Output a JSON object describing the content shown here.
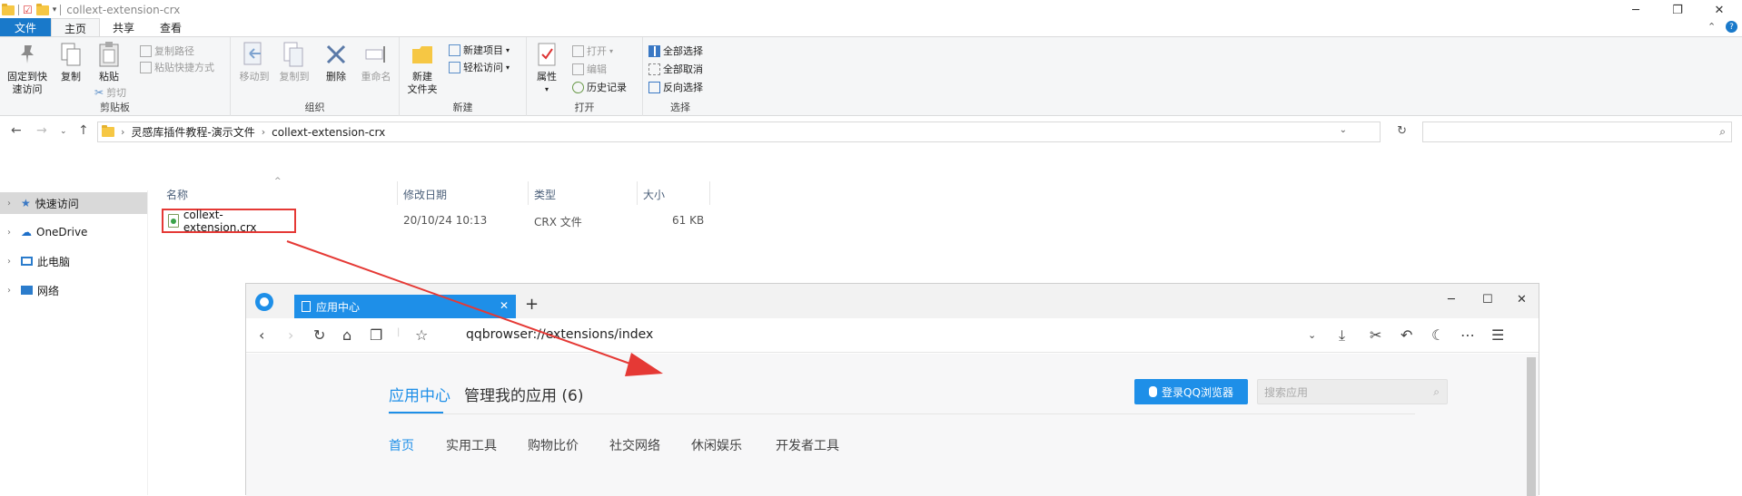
{
  "window": {
    "title": "collext-extension-crx"
  },
  "ribbon_tabs": [
    "文件",
    "主页",
    "共享",
    "查看"
  ],
  "ribbon": {
    "clipboard": {
      "label": "剪贴板",
      "pin": "固定到快\n速访问",
      "copy": "复制",
      "paste": "粘贴",
      "copy_path": "复制路径",
      "paste_shortcut": "粘贴快捷方式",
      "cut": "剪切"
    },
    "organize": {
      "label": "组织",
      "move_to": "移动到",
      "copy_to": "复制到",
      "delete": "删除",
      "rename": "重命名"
    },
    "new": {
      "label": "新建",
      "new_folder": "新建\n文件夹",
      "new_item": "新建项目",
      "easy_access": "轻松访问"
    },
    "open": {
      "label": "打开",
      "properties": "属性",
      "open": "打开",
      "edit": "编辑",
      "history": "历史记录"
    },
    "select": {
      "label": "选择",
      "select_all": "全部选择",
      "select_none": "全部取消",
      "invert": "反向选择"
    }
  },
  "address": {
    "crumbs": [
      "灵感库插件教程-演示文件",
      "collext-extension-crx"
    ]
  },
  "navpane": [
    "快速访问",
    "OneDrive",
    "此电脑",
    "网络"
  ],
  "columns": [
    "名称",
    "修改日期",
    "类型",
    "大小"
  ],
  "file": {
    "name": "collext-extension.crx",
    "date": "20/10/24 10:13",
    "type": "CRX 文件",
    "size": "61 KB"
  },
  "browser": {
    "tab_title": "应用中心",
    "url": "qqbrowser://extensions/index",
    "app_tabs": [
      "应用中心",
      "管理我的应用 (6)"
    ],
    "login": "登录QQ浏览器",
    "search_placeholder": "搜索应用",
    "categories": [
      "首页",
      "实用工具",
      "购物比价",
      "社交网络",
      "休闲娱乐",
      "开发者工具"
    ]
  },
  "colors": {
    "accent": "#1e8fe8",
    "highlight": "#e53935",
    "file_tab": "#1979ca"
  }
}
